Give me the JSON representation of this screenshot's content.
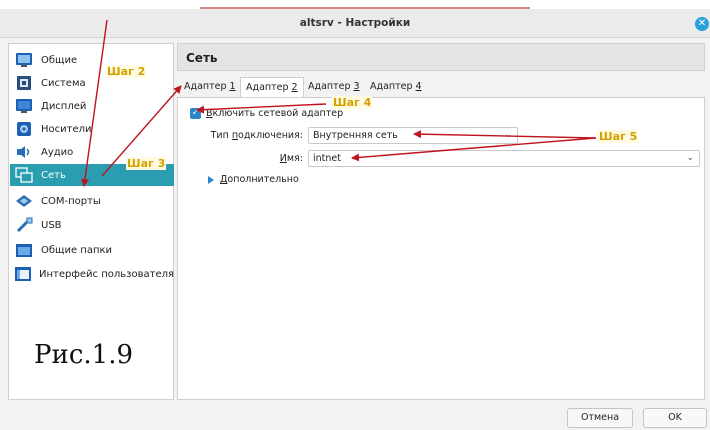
{
  "window": {
    "title": "altsrv - Настройки",
    "close_icon": "close-icon"
  },
  "sidebar": {
    "items": [
      {
        "label": "Общие",
        "icon": "general-icon"
      },
      {
        "label": "Система",
        "icon": "system-icon"
      },
      {
        "label": "Дисплей",
        "icon": "display-icon"
      },
      {
        "label": "Носители",
        "icon": "storage-icon"
      },
      {
        "label": "Аудио",
        "icon": "audio-icon"
      },
      {
        "label": "Сеть",
        "icon": "network-icon",
        "active": true
      },
      {
        "label": "COM-порты",
        "icon": "serial-port-icon"
      },
      {
        "label": "USB",
        "icon": "usb-icon"
      },
      {
        "label": "Общие папки",
        "icon": "shared-folder-icon"
      },
      {
        "label": "Интерфейс пользователя",
        "icon": "user-interface-icon"
      }
    ]
  },
  "caption": "Рис.1.9",
  "main": {
    "section_title": "Сеть",
    "tabs": [
      {
        "text": "Адаптер ",
        "accel": "1"
      },
      {
        "text": "Адаптер ",
        "accel": "2",
        "active": true
      },
      {
        "text": "Адаптер ",
        "accel": "3"
      },
      {
        "text": "Адаптер ",
        "accel": "4"
      }
    ],
    "enable_adapter": {
      "checked": true,
      "label_accel": "В",
      "label_rest": "ключить сетевой адаптер"
    },
    "attached_to": {
      "label_pre": "Тип ",
      "label_accel": "п",
      "label_post": "одключения:",
      "value": "Внутренняя сеть"
    },
    "name": {
      "label_accel": "И",
      "label_post": "мя:",
      "value": "intnet"
    },
    "advanced": {
      "label_accel": "Д",
      "label_rest": "ополнительно"
    }
  },
  "buttons": {
    "cancel": "Отмена",
    "ok": "OK"
  },
  "annotations": {
    "step2": "Шаг 2",
    "step3": "Шаг 3",
    "step4": "Шаг 4",
    "step5": "Шаг 5",
    "arrow_color": "#c0141c",
    "note_color": "#d4a000"
  }
}
